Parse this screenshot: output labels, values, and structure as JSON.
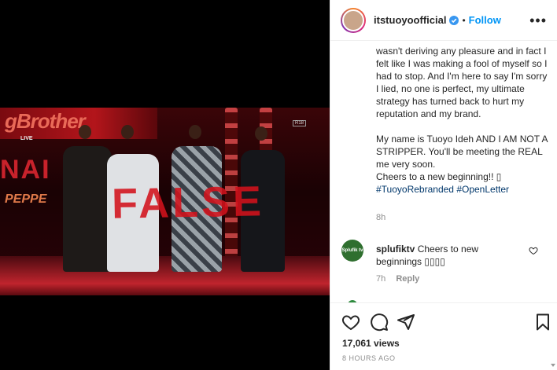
{
  "header": {
    "username": "itstuoyoofficial",
    "separator": "•",
    "follow_label": "Follow",
    "more_icon": "more-options-icon"
  },
  "media": {
    "banner_text": "gBrother",
    "live_tag": "LIVE",
    "age_rating": "R18",
    "naija_text": "NAI",
    "pepper_text": "PEPPE",
    "overlay_text": "FALSE"
  },
  "caption": {
    "para1": "wasn't deriving any pleasure and in fact I felt like I was making a fool of myself so I had to stop. And I'm here to say I'm sorry I lied, no one is perfect, my ultimate strategy has turned back to hurt my reputation and my brand.",
    "para2": "My name is Tuoyo Ideh AND I AM NOT A STRIPPER. You'll be meeting the REAL me very soon.",
    "para3": "Cheers to a new beginning!! ▯",
    "hashtag1": "#TuoyoRebranded",
    "hashtag2": "#OpenLetter",
    "time": "8h"
  },
  "comment": {
    "avatar_text": "Splufik tv",
    "username": "splufiktv",
    "text": "Cheers to new beginnings ▯▯▯▯",
    "time": "7h",
    "reply_label": "Reply"
  },
  "footer": {
    "views": "17,061 views",
    "age": "8 HOURS AGO"
  },
  "colors": {
    "accent": "#0095f6",
    "stamp": "#d3121c",
    "text": "#262626",
    "muted": "#8e8e8e"
  }
}
